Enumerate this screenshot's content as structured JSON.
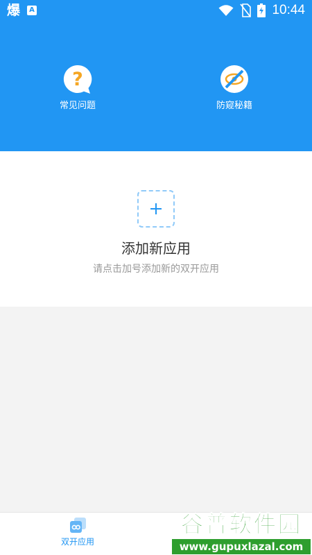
{
  "status_bar": {
    "app_glyph": "爆",
    "notification_badge": "A",
    "time": "10:44"
  },
  "header": {
    "faq_label": "常见问题",
    "anti_ban_label": "防窥秘籍"
  },
  "empty_state": {
    "title": "添加新应用",
    "hint": "请点击加号添加新的双开应用"
  },
  "tab_bar": {
    "dual_apps_label": "双开应用"
  },
  "watermark": {
    "brand": "谷普软件园",
    "url": "www.gupuxlazal.com"
  },
  "colors": {
    "primary": "#2196f3",
    "faq_icon": "#f5a623",
    "anti_ban_icon": "#f5a623",
    "dashed_border": "#90caf9",
    "watermark": "#2e9e2e"
  },
  "icons": {
    "faq": "question-bubble-icon",
    "anti_ban": "eye-blocked-icon",
    "add": "plus-icon",
    "tab": "dual-apps-icon",
    "wifi": "wifi-icon",
    "no_sim": "no-sim-icon",
    "battery": "battery-charging-icon"
  }
}
